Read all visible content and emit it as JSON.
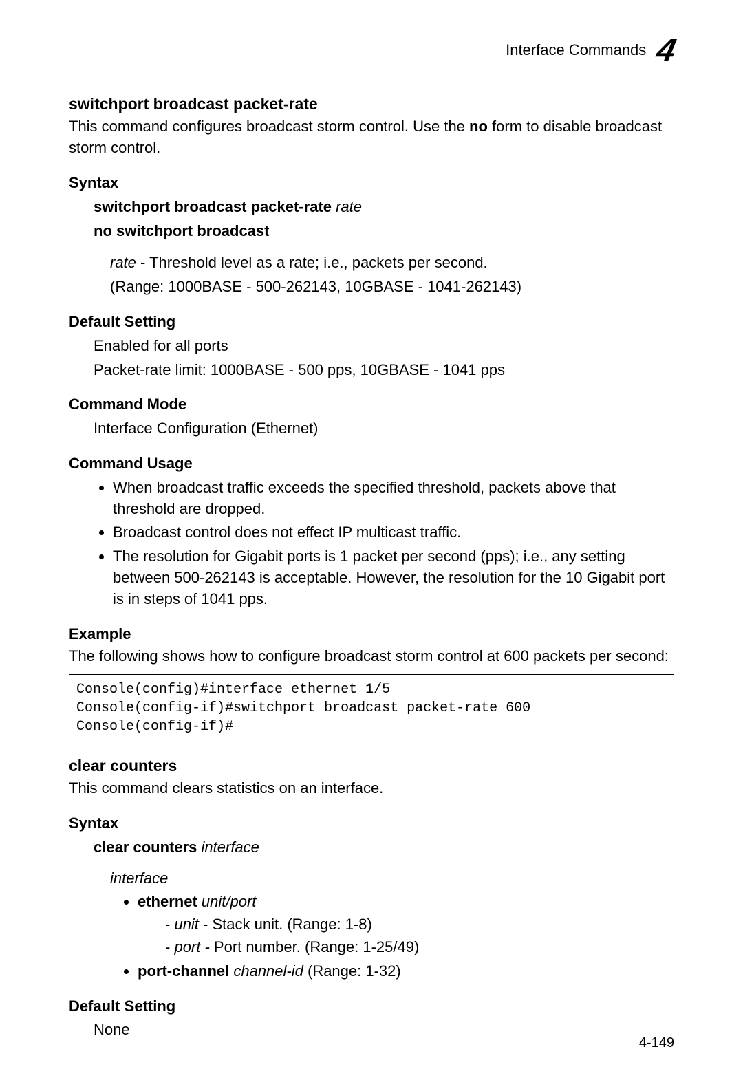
{
  "header": {
    "section": "Interface Commands",
    "chapter": "4"
  },
  "cmd1": {
    "title": "switchport broadcast packet-rate",
    "desc_pre": "This command configures broadcast storm control. Use the ",
    "desc_bold": "no",
    "desc_post": " form to disable broadcast storm control.",
    "syntax_head": "Syntax",
    "syntax_line1_bold": "switchport broadcast packet-rate",
    "syntax_line1_ital": " rate",
    "syntax_line2": "no switchport broadcast",
    "param_rate_ital": "rate",
    "param_rate_text": " - Threshold level as a rate; i.e., packets per second.",
    "param_range": "(Range: 1000BASE - 500-262143, 10GBASE - 1041-262143)",
    "default_head": "Default Setting",
    "default_l1": "Enabled for all ports",
    "default_l2": "Packet-rate limit: 1000BASE - 500 pps, 10GBASE - 1041 pps",
    "mode_head": "Command Mode",
    "mode_text": "Interface Configuration (Ethernet)",
    "usage_head": "Command Usage",
    "usage_b1": "When broadcast traffic exceeds the specified threshold, packets above that threshold are dropped.",
    "usage_b2": "Broadcast control does not effect IP multicast traffic.",
    "usage_b3": "The resolution for Gigabit ports is 1 packet per second (pps); i.e., any setting between 500-262143 is acceptable. However, the resolution for the 10 Gigabit port is in steps of 1041 pps.",
    "example_head": "Example",
    "example_intro": "The following shows how to configure broadcast storm control at 600 packets per second:",
    "example_code": "Console(config)#interface ethernet 1/5\nConsole(config-if)#switchport broadcast packet-rate 600\nConsole(config-if)#"
  },
  "cmd2": {
    "title": "clear counters",
    "desc": "This command clears statistics on an interface.",
    "syntax_head": "Syntax",
    "syntax_bold": "clear counters",
    "syntax_ital": " interface",
    "iface_label": "interface",
    "eth_bold": "ethernet",
    "eth_ital": " unit/port",
    "unit_ital": "unit",
    "unit_text": " - Stack unit. (Range: 1-8)",
    "port_ital": "port -",
    "port_text": " Port number. (Range: 1-25/49)",
    "pc_bold": "port-channel",
    "pc_ital": " channel-id",
    "pc_text": " (Range: 1-32)",
    "default_head": "Default Setting",
    "default_text": "None"
  },
  "pagenum": "4-149"
}
